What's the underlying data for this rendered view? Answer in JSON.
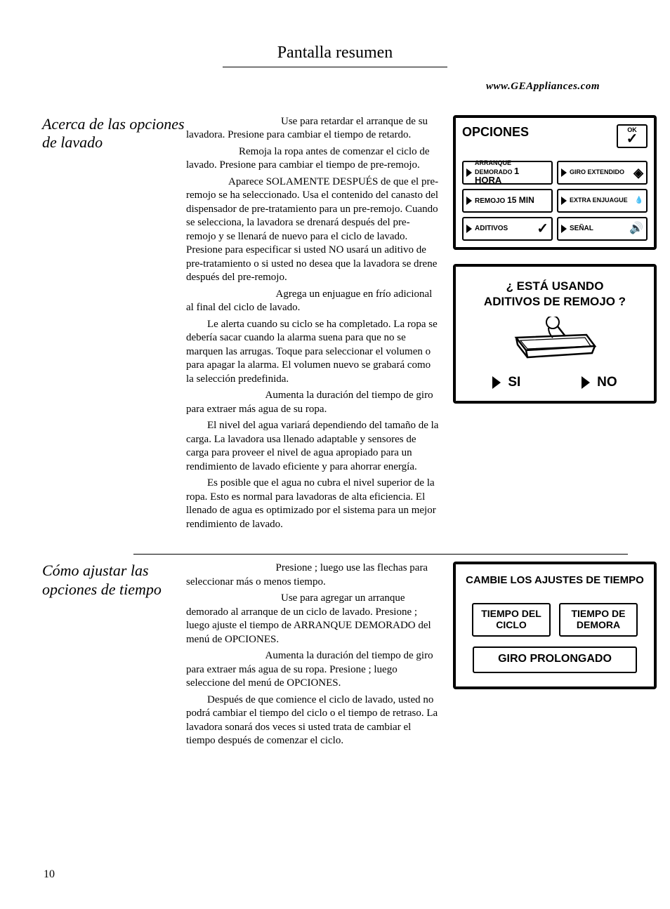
{
  "page_title": "Pantalla resumen",
  "url": "www.GEAppliances.com",
  "page_number": "10",
  "section1": {
    "heading": "Acerca de las opciones de lavado",
    "paragraphs": [
      "Use para retardar el arranque de su lavadora. Presione para cambiar el tiempo de retardo.",
      "Remoja la ropa antes de comenzar el ciclo de lavado. Presione para cambiar el tiempo de pre-remojo.",
      "Aparece SOLAMENTE DESPUÉS de que el pre-remojo se ha seleccionado. Usa el contenido del canasto del dispensador de pre-tratamiento para un pre-remojo. Cuando se selecciona, la lavadora se drenará después del pre-remojo y se llenará de nuevo para el ciclo de lavado. Presione para especificar si usted NO usará un aditivo de pre-tratamiento o si usted no desea que la lavadora se drene después del pre-remojo.",
      "Agrega un enjuague en frío adicional al final del ciclo de lavado.",
      "Le alerta cuando su ciclo se ha completado. La ropa se debería sacar cuando la alarma suena para que no se marquen las arrugas. Toque para seleccionar el volumen o para apagar la alarma. El volumen nuevo se grabará como la selección predefinida.",
      "Aumenta la duración del tiempo de giro para extraer más agua de su ropa.",
      "El nivel del agua variará dependiendo del tamaño de la carga. La lavadora usa llenado adaptable y sensores de carga para proveer el nivel de agua apropiado para un rendimiento de lavado eficiente y para ahorrar energía.",
      "Es posible que el agua no cubra el nivel superior de la ropa. Esto es normal para lavadoras de alta eficiencia. El llenado de agua es optimizado por el sistema para un mejor rendimiento de lavado."
    ]
  },
  "section2": {
    "heading": "Cómo ajustar las opciones de tiempo",
    "paragraphs": [
      "Presione ; luego use las flechas para seleccionar más o menos tiempo.",
      "Use para agregar un arranque demorado al arranque de un ciclo de lavado. Presione ; luego ajuste el tiempo de ARRANQUE DEMORADO del menú de OPCIONES.",
      "Aumenta la duración del tiempo de giro para extraer más agua de su ropa. Presione ; luego seleccione del menú de OPCIONES.",
      "Después de que comience el ciclo de lavado, usted no podrá cambiar el tiempo del ciclo o el tiempo de retraso. La lavadora sonará dos veces si usted trata de cambiar el tiempo después de comenzar el ciclo."
    ]
  },
  "panel_opciones": {
    "title": "OPCIONES",
    "ok": "OK",
    "buttons": {
      "arranque": "ARRANQUE DEMORADO",
      "arranque_val": "1 HORA",
      "giro": "GIRO EXTENDIDO",
      "remojo": "REMOJO",
      "remojo_val": "15 MIN",
      "extra": "EXTRA ENJUAGUE",
      "aditivos": "ADITIVOS",
      "senal": "SEÑAL"
    }
  },
  "panel_aditivos": {
    "title1": "¿ ESTÁ USANDO",
    "title2": "ADITIVOS DE REMOJO ?",
    "si": "SI",
    "no": "NO"
  },
  "panel_tiempo": {
    "title": "CAMBIE LOS AJUSTES DE TIEMPO",
    "tiempo_ciclo": "TIEMPO DEL CICLO",
    "tiempo_demora": "TIEMPO DE DEMORA",
    "giro": "GIRO PROLONGADO"
  }
}
